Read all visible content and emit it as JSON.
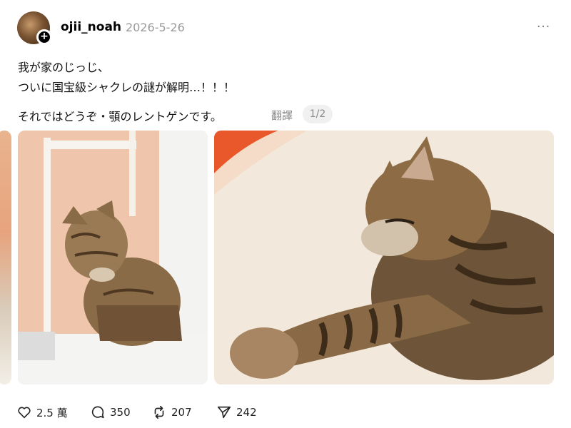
{
  "post": {
    "username": "ojii_noah",
    "date": "2026-5-26",
    "more_label": "···",
    "line1": "我が家のじっじ、",
    "line2": "ついに国宝級シャクレの謎が解明…！！！",
    "line3": "それではどうぞ・顎のレントゲンです。",
    "translate_label": "翻譯",
    "page_indicator": "1/2"
  },
  "actions": {
    "likes": "2.5 萬",
    "replies": "350",
    "reposts": "207",
    "shares": "242"
  },
  "icons": {
    "avatar_plus": "+",
    "like": "heart-icon",
    "reply": "comment-icon",
    "repost": "repost-icon",
    "share": "send-icon"
  }
}
